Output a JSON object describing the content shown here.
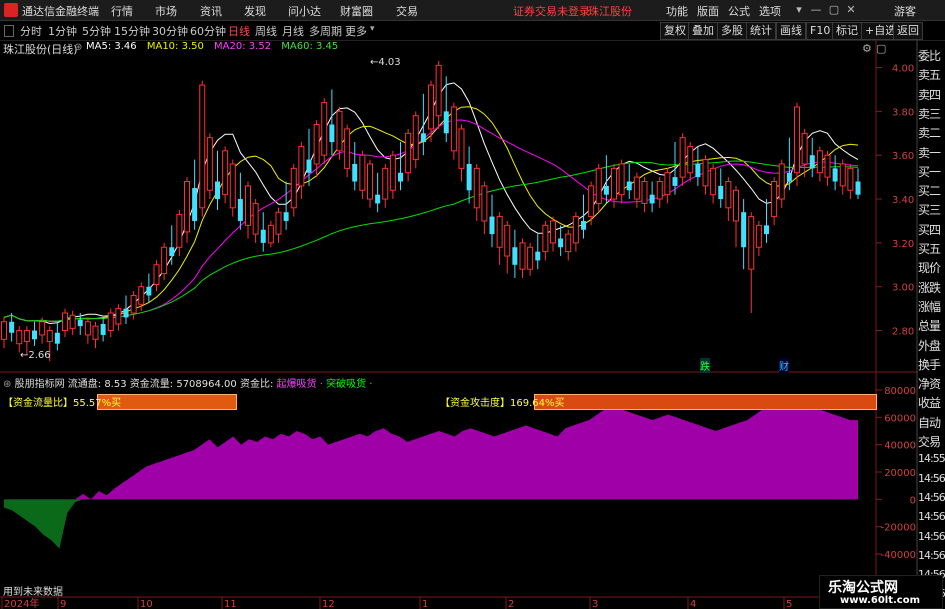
{
  "app": {
    "name": "通达信金融终端",
    "alert": "证券交易未登录",
    "stock_button": "珠江股份"
  },
  "menu": [
    "行情",
    "市场",
    "资讯",
    "发现",
    "问小达",
    "财富圈",
    "交易"
  ],
  "right_menu": [
    "功能",
    "版面",
    "公式",
    "选项"
  ],
  "guest": "游客",
  "periods": [
    {
      "label": "分时",
      "active": false
    },
    {
      "label": "1分钟",
      "active": false
    },
    {
      "label": "5分钟",
      "active": false
    },
    {
      "label": "15分钟",
      "active": false
    },
    {
      "label": "30分钟",
      "active": false
    },
    {
      "label": "60分钟",
      "active": false
    },
    {
      "label": "日线",
      "active": true
    },
    {
      "label": "周线",
      "active": false
    },
    {
      "label": "月线",
      "active": false
    },
    {
      "label": "多周期",
      "active": false
    },
    {
      "label": "更多",
      "active": false
    }
  ],
  "toolbar": [
    "复权",
    "叠加",
    "多股",
    "统计",
    "画线",
    "F10",
    "标记",
    "+自选",
    "返回"
  ],
  "stock": {
    "title": "珠江股份(日线)",
    "ma_items": [
      {
        "label": "MA5: 3.46",
        "color": "#ffffff"
      },
      {
        "label": "MA10: 3.50",
        "color": "#f0f000"
      },
      {
        "label": "MA20: 3.52",
        "color": "#ff00ff"
      },
      {
        "label": "MA60: 3.45",
        "color": "#00e000"
      }
    ],
    "high_label": "4.03",
    "low_label": "2.66",
    "event_labels": [
      "跌",
      "财"
    ]
  },
  "indicator": {
    "title": "股朋指标网",
    "items": [
      {
        "label": "流通盘: 8.53",
        "color": "#e0e0e0"
      },
      {
        "label": "资金流量: 5708964.00",
        "color": "#e0e0e0"
      },
      {
        "label": "资金比:",
        "color": "#e0e0e0"
      },
      {
        "label": "起爆吸货",
        "color": "#ff40ff"
      },
      {
        "label": "·",
        "color": "#ff40ff"
      },
      {
        "label": "突破吸货",
        "color": "#00ff00"
      },
      {
        "label": "·",
        "color": "#00ff00"
      }
    ],
    "flow_ratio_label": "【资金流量比】55.57%买",
    "attack_label": "【资金攻击度】169.64%买",
    "future_data_label": "用到未来数据"
  },
  "side_panel": [
    "委比",
    "卖五",
    "卖四",
    "卖三",
    "卖二",
    "卖一",
    "买一",
    "买二",
    "买三",
    "买四",
    "买五",
    "现价",
    "涨跌",
    "涨幅",
    "总量",
    "外盘",
    "换手",
    "净资",
    "收益",
    "自动",
    "交易",
    "14:55",
    "14:56",
    "14:56",
    "14:56",
    "14:56",
    "14:56",
    "14:56",
    "14:56"
  ],
  "watermark": {
    "line1": "乐淘公式网",
    "line2": "www.60lt.com"
  },
  "chart_data": [
    {
      "type": "candlestick",
      "title": "珠江股份(日线)",
      "y_ticks": [
        "4.00",
        "3.80",
        "3.60",
        "3.40",
        "3.20",
        "3.00",
        "2.80"
      ],
      "x_labels": [
        "2024年",
        "9",
        "10",
        "11",
        "12",
        "1",
        "2",
        "3",
        "4",
        "5"
      ],
      "ylim": [
        2.66,
        4.03
      ],
      "series": [
        {
          "name": "MA5",
          "color": "#ffffff"
        },
        {
          "name": "MA10",
          "color": "#f0f000"
        },
        {
          "name": "MA20",
          "color": "#ff00ff"
        },
        {
          "name": "MA60",
          "color": "#00e000"
        }
      ],
      "ohlc": [
        [
          2.8,
          2.86,
          2.76,
          2.72
        ],
        [
          2.84,
          2.88,
          2.79,
          2.75
        ],
        [
          2.78,
          2.82,
          2.74,
          2.7
        ],
        [
          2.76,
          2.82,
          2.75,
          2.69
        ],
        [
          2.8,
          2.84,
          2.76,
          2.73
        ],
        [
          2.82,
          2.86,
          2.78,
          2.74
        ],
        [
          2.8,
          2.82,
          2.75,
          2.66
        ],
        [
          2.79,
          2.84,
          2.74,
          2.71
        ],
        [
          2.83,
          2.9,
          2.8,
          2.77
        ],
        [
          2.86,
          2.89,
          2.81,
          2.78
        ],
        [
          2.85,
          2.88,
          2.82,
          2.78
        ],
        [
          2.82,
          2.86,
          2.78,
          2.74
        ],
        [
          2.8,
          2.84,
          2.76,
          2.72
        ],
        [
          2.83,
          2.86,
          2.78,
          2.75
        ],
        [
          2.85,
          2.9,
          2.8,
          2.77
        ],
        [
          2.86,
          2.92,
          2.83,
          2.8
        ],
        [
          2.9,
          2.96,
          2.86,
          2.83
        ],
        [
          2.93,
          2.98,
          2.88,
          2.85
        ],
        [
          2.96,
          3.02,
          2.92,
          2.89
        ],
        [
          3.0,
          3.06,
          2.96,
          2.93
        ],
        [
          3.05,
          3.12,
          3.01,
          2.98
        ],
        [
          3.1,
          3.2,
          3.06,
          3.03
        ],
        [
          3.18,
          3.28,
          3.14,
          3.1
        ],
        [
          3.22,
          3.35,
          3.18,
          3.14
        ],
        [
          3.3,
          3.5,
          3.25,
          3.2
        ],
        [
          3.45,
          3.58,
          3.3,
          3.26
        ],
        [
          3.4,
          3.94,
          3.36,
          3.32
        ],
        [
          3.55,
          3.7,
          3.44,
          3.4
        ],
        [
          3.48,
          3.62,
          3.4,
          3.35
        ],
        [
          3.52,
          3.64,
          3.42,
          3.38
        ],
        [
          3.46,
          3.58,
          3.36,
          3.32
        ],
        [
          3.4,
          3.52,
          3.3,
          3.26
        ],
        [
          3.36,
          3.48,
          3.28,
          3.22
        ],
        [
          3.3,
          3.4,
          3.24,
          3.2
        ],
        [
          3.26,
          3.34,
          3.2,
          3.16
        ],
        [
          3.24,
          3.3,
          3.2,
          3.18
        ],
        [
          3.28,
          3.36,
          3.24,
          3.2
        ],
        [
          3.34,
          3.48,
          3.3,
          3.26
        ],
        [
          3.4,
          3.56,
          3.36,
          3.32
        ],
        [
          3.5,
          3.66,
          3.46,
          3.4
        ],
        [
          3.58,
          3.72,
          3.52,
          3.46
        ],
        [
          3.64,
          3.76,
          3.56,
          3.5
        ],
        [
          3.7,
          3.86,
          3.6,
          3.56
        ],
        [
          3.74,
          3.9,
          3.66,
          3.6
        ],
        [
          3.7,
          3.82,
          3.62,
          3.58
        ],
        [
          3.62,
          3.74,
          3.54,
          3.5
        ],
        [
          3.56,
          3.66,
          3.48,
          3.44
        ],
        [
          3.5,
          3.62,
          3.44,
          3.4
        ],
        [
          3.46,
          3.58,
          3.4,
          3.36
        ],
        [
          3.42,
          3.52,
          3.38,
          3.34
        ],
        [
          3.44,
          3.56,
          3.4,
          3.36
        ],
        [
          3.48,
          3.62,
          3.44,
          3.4
        ],
        [
          3.52,
          3.66,
          3.48,
          3.44
        ],
        [
          3.56,
          3.72,
          3.52,
          3.48
        ],
        [
          3.62,
          3.8,
          3.58,
          3.54
        ],
        [
          3.7,
          3.88,
          3.66,
          3.6
        ],
        [
          3.78,
          3.94,
          3.72,
          3.66
        ],
        [
          3.84,
          4.03,
          3.78,
          3.72
        ],
        [
          3.8,
          3.96,
          3.7,
          3.66
        ],
        [
          3.72,
          3.84,
          3.62,
          3.58
        ],
        [
          3.64,
          3.74,
          3.54,
          3.48
        ],
        [
          3.56,
          3.64,
          3.44,
          3.38
        ],
        [
          3.48,
          3.56,
          3.36,
          3.3
        ],
        [
          3.4,
          3.48,
          3.3,
          3.24
        ],
        [
          3.32,
          3.42,
          3.24,
          3.18
        ],
        [
          3.26,
          3.34,
          3.18,
          3.1
        ],
        [
          3.22,
          3.3,
          3.14,
          3.06
        ],
        [
          3.18,
          3.26,
          3.1,
          3.04
        ],
        [
          3.14,
          3.22,
          3.08,
          3.04
        ],
        [
          3.12,
          3.2,
          3.08,
          3.05
        ],
        [
          3.16,
          3.24,
          3.12,
          3.08
        ],
        [
          3.2,
          3.3,
          3.16,
          3.12
        ],
        [
          3.24,
          3.32,
          3.2,
          3.16
        ],
        [
          3.22,
          3.28,
          3.18,
          3.14
        ],
        [
          3.2,
          3.26,
          3.16,
          3.12
        ],
        [
          3.24,
          3.34,
          3.2,
          3.16
        ],
        [
          3.3,
          3.42,
          3.26,
          3.22
        ],
        [
          3.36,
          3.48,
          3.32,
          3.28
        ],
        [
          3.42,
          3.56,
          3.38,
          3.34
        ],
        [
          3.46,
          3.6,
          3.42,
          3.38
        ],
        [
          3.44,
          3.56,
          3.4,
          3.36
        ],
        [
          3.46,
          3.58,
          3.42,
          3.38
        ],
        [
          3.48,
          3.56,
          3.44,
          3.4
        ],
        [
          3.46,
          3.52,
          3.4,
          3.36
        ],
        [
          3.44,
          3.5,
          3.38,
          3.34
        ],
        [
          3.42,
          3.48,
          3.38,
          3.34
        ],
        [
          3.44,
          3.5,
          3.4,
          3.36
        ],
        [
          3.46,
          3.54,
          3.42,
          3.38
        ],
        [
          3.5,
          3.66,
          3.46,
          3.42
        ],
        [
          3.56,
          3.7,
          3.5,
          3.46
        ],
        [
          3.58,
          3.66,
          3.52,
          3.48
        ],
        [
          3.56,
          3.64,
          3.5,
          3.46
        ],
        [
          3.52,
          3.6,
          3.46,
          3.42
        ],
        [
          3.48,
          3.56,
          3.42,
          3.38
        ],
        [
          3.46,
          3.54,
          3.4,
          3.36
        ],
        [
          3.44,
          3.5,
          3.36,
          3.3
        ],
        [
          3.4,
          3.46,
          3.3,
          3.18
        ],
        [
          3.34,
          3.4,
          3.18,
          3.08
        ],
        [
          3.26,
          3.34,
          3.08,
          2.88
        ],
        [
          3.22,
          3.3,
          3.18,
          3.14
        ],
        [
          3.28,
          3.4,
          3.24,
          3.2
        ],
        [
          3.36,
          3.5,
          3.32,
          3.28
        ],
        [
          3.44,
          3.58,
          3.4,
          3.36
        ],
        [
          3.52,
          3.68,
          3.48,
          3.44
        ],
        [
          3.58,
          3.84,
          3.52,
          3.46
        ],
        [
          3.62,
          3.72,
          3.56,
          3.5
        ],
        [
          3.6,
          3.68,
          3.54,
          3.5
        ],
        [
          3.58,
          3.64,
          3.52,
          3.48
        ],
        [
          3.56,
          3.62,
          3.5,
          3.46
        ],
        [
          3.54,
          3.6,
          3.48,
          3.44
        ],
        [
          3.52,
          3.58,
          3.46,
          3.42
        ],
        [
          3.5,
          3.56,
          3.44,
          3.4
        ],
        [
          3.48,
          3.54,
          3.42,
          3.4
        ]
      ]
    },
    {
      "type": "area",
      "title": "股朋指标网",
      "y_ticks": [
        "80000",
        "60000",
        "40000",
        "20000",
        "0",
        "-20000",
        "-40000"
      ],
      "ylim": [
        -40000,
        80000
      ],
      "series": [
        {
          "name": "资金流量",
          "color": "#a000a0"
        }
      ],
      "values": [
        -6000,
        -8000,
        -12000,
        -16000,
        -20000,
        -26000,
        -30000,
        -36000,
        -10000,
        -2000,
        4000,
        0,
        6000,
        3000,
        8000,
        12000,
        16000,
        20000,
        24000,
        26000,
        28000,
        30000,
        32000,
        34000,
        36000,
        40000,
        44000,
        38000,
        42000,
        46000,
        40000,
        44000,
        42000,
        46000,
        44000,
        48000,
        46000,
        50000,
        48000,
        44000,
        46000,
        40000,
        42000,
        44000,
        46000,
        48000,
        46000,
        50000,
        52000,
        48000,
        46000,
        42000,
        44000,
        46000,
        48000,
        50000,
        48000,
        46000,
        50000,
        52000,
        50000,
        48000,
        46000,
        48000,
        50000,
        52000,
        54000,
        52000,
        50000,
        48000,
        46000,
        52000,
        54000,
        56000,
        58000,
        62000,
        66000,
        68000,
        66000,
        64000,
        62000,
        60000,
        58000,
        60000,
        62000,
        60000,
        58000,
        56000,
        54000,
        52000,
        50000,
        52000,
        54000,
        56000,
        58000,
        62000,
        66000,
        72000,
        76000,
        74000,
        72000,
        70000,
        68000,
        66000,
        64000,
        62000,
        60000,
        58000,
        58000
      ]
    }
  ]
}
